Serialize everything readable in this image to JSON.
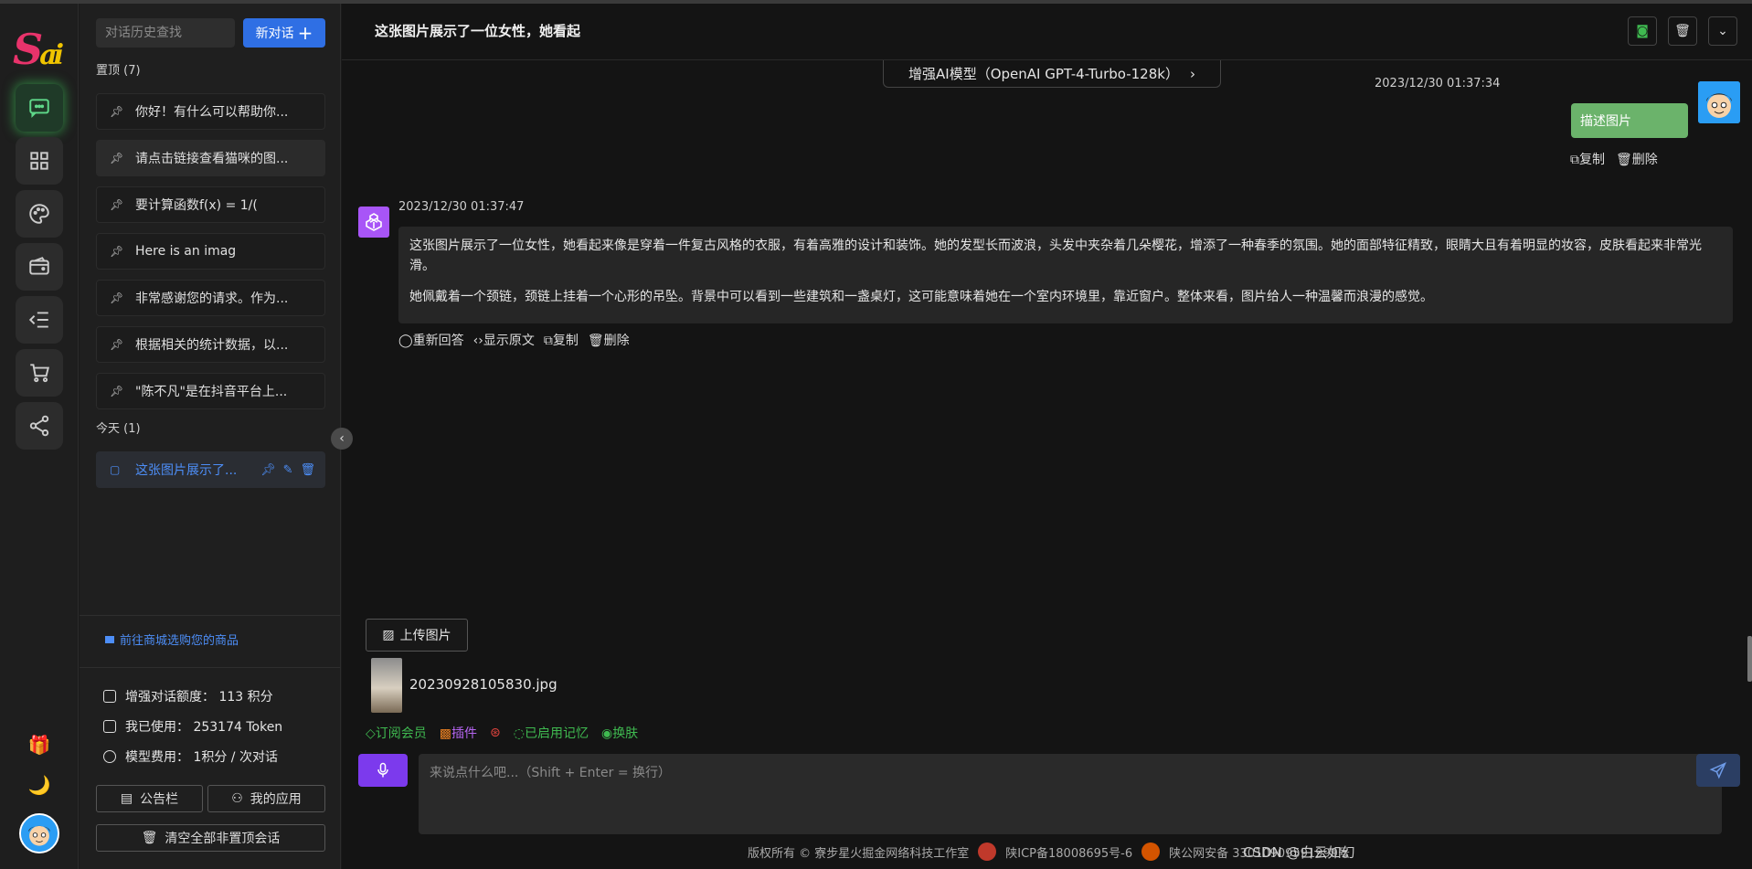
{
  "sidebar": {
    "search_placeholder": "对话历史查找",
    "new_chat_label": "新对话",
    "pinned_label": "置顶 (7)",
    "pinned_items": [
      "你好！有什么可以帮助你...",
      "请点击链接查看猫咪的图...",
      "要计算函数f(x) = 1/(",
      "Here is an imag",
      "非常感谢您的请求。作为...",
      "根据相关的统计数据，以...",
      "\"陈不凡\"是在抖音平台上..."
    ],
    "today_label": "今天 (1)",
    "today_items": [
      "这张图片展示了..."
    ],
    "shop_link": "前往商城选购您的商品",
    "stats": {
      "quota": "增强对话额度： 113 积分",
      "used": "我已使用： 253174 Token",
      "fee": "模型费用： 1积分 / 次对话"
    },
    "notice_label": "公告栏",
    "my_apps_label": "我的应用",
    "clear_label": "清空全部非置顶会话"
  },
  "header": {
    "title": "这张图片展示了一位女性，她看起"
  },
  "model_label": "增强AI模型（OpenAI GPT-4-Turbo-128k）",
  "user_message": {
    "time": "2023/12/30 01:37:34",
    "text": "描述图片",
    "copy_label": "复制",
    "delete_label": "删除"
  },
  "ai_message": {
    "time": "2023/12/30 01:37:47",
    "paragraph1": "这张图片展示了一位女性，她看起来像是穿着一件复古风格的衣服，有着高雅的设计和装饰。她的发型长而波浪，头发中夹杂着几朵樱花，增添了一种春季的氛围。她的面部特征精致，眼睛大且有着明显的妆容，皮肤看起来非常光滑。",
    "paragraph2": "她佩戴着一个颈链，颈链上挂着一个心形的吊坠。背景中可以看到一些建筑和一盏桌灯，这可能意味着她在一个室内环境里，靠近窗户。整体来看，图片给人一种温馨而浪漫的感觉。",
    "regenerate_label": "重新回答",
    "raw_label": "显示原文",
    "copy_label": "复制",
    "delete_label": "删除"
  },
  "composer": {
    "upload_label": "上传图片",
    "file_name": "20230928105830.jpg",
    "subscribe_label": "订阅会员",
    "plugin_label": "插件",
    "memory_label": "已启用记忆",
    "skin_label": "换肤",
    "input_placeholder": "来说点什么吧...（Shift + Enter = 换行）"
  },
  "footer": {
    "copyright": "版权所有 © 寮步星火掘金网络科技工作室",
    "icp": "陕ICP备18008695号-6",
    "police": "陕公网安备 33010909591999号"
  },
  "watermark": "CSDN @白云如幻",
  "colors": {
    "accent_blue": "#2f6fe4",
    "accent_green": "#3fb950",
    "accent_purple": "#7c3aed",
    "user_bubble": "#6bb36b"
  }
}
